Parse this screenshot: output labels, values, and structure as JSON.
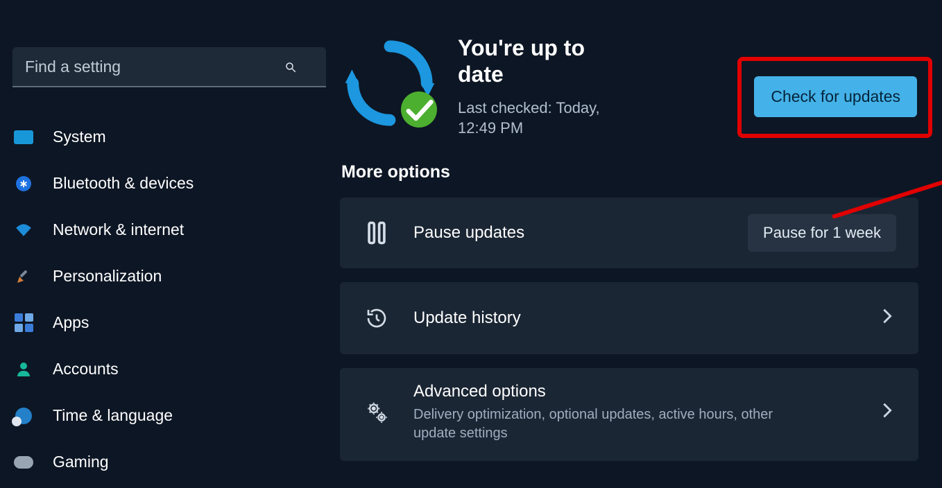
{
  "search": {
    "placeholder": "Find a setting"
  },
  "sidebar": {
    "items": [
      {
        "label": "System"
      },
      {
        "label": "Bluetooth & devices"
      },
      {
        "label": "Network & internet"
      },
      {
        "label": "Personalization"
      },
      {
        "label": "Apps"
      },
      {
        "label": "Accounts"
      },
      {
        "label": "Time & language"
      },
      {
        "label": "Gaming"
      }
    ]
  },
  "status": {
    "title": "You're up to date",
    "subline": "Last checked: Today, 12:49 PM"
  },
  "check_button": "Check for updates",
  "more_options_heading": "More options",
  "cards": {
    "pause": {
      "title": "Pause updates",
      "action": "Pause for 1 week"
    },
    "history": {
      "title": "Update history"
    },
    "advanced": {
      "title": "Advanced options",
      "sub": "Delivery optimization, optional updates, active hours, other update settings"
    }
  }
}
